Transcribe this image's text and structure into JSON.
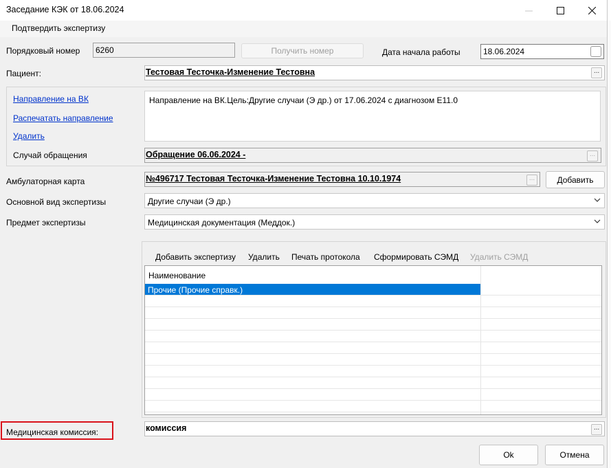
{
  "window": {
    "title": "Заседание КЭК от 18.06.2024"
  },
  "menu": {
    "confirm_label": "Подтвердить экспертизу"
  },
  "seq": {
    "label": "Порядковый номер",
    "value": "6260",
    "get_number_label": "Получить номер"
  },
  "start_date": {
    "label": "Дата начала работы",
    "value": "18.06.2024"
  },
  "patient": {
    "label": "Пациент:",
    "value": "Тестовая Тесточка-Изменение Тестовна"
  },
  "referral": {
    "link_referral": "Направление на ВК",
    "link_print": "Распечатать направление",
    "link_delete": "Удалить",
    "text": "Направление на ВК.Цель:Другие случаи (Э др.) от 17.06.2024 с диагнозом E11.0"
  },
  "case": {
    "label": "Случай обращения",
    "value": "Обращение 06.06.2024 -"
  },
  "amb_card": {
    "label": "Амбулаторная карта",
    "value": "№496717 Тестовая Тесточка-Изменение Тестовна 10.10.1974",
    "add_label": "Добавить"
  },
  "exam_type": {
    "label": "Основной вид экспертизы",
    "value": "Другие случаи (Э др.)"
  },
  "exam_subject": {
    "label": "Предмет экспертизы",
    "value": "Медицинская документация (Меддок.)"
  },
  "grid_toolbar": {
    "add": "Добавить экспертизу",
    "delete": "Удалить",
    "print": "Печать протокола",
    "form_semd": "Сформировать СЭМД",
    "delete_semd": "Удалить СЭМД"
  },
  "grid": {
    "header": "Наименование",
    "rows": [
      "Прочие (Прочие справк.)"
    ]
  },
  "commission": {
    "label": "Медицинская комиссия:",
    "value": "комиссия"
  },
  "footer": {
    "ok": "Ok",
    "cancel": "Отмена"
  },
  "colors": {
    "highlight": "#0078d7",
    "callout": "#d9121b",
    "link": "#0033cc"
  }
}
